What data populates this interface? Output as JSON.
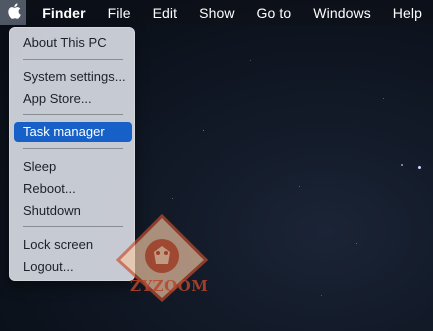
{
  "menubar": {
    "apple_icon": "apple-logo-icon",
    "items": [
      {
        "label": "Finder"
      },
      {
        "label": "File"
      },
      {
        "label": "Edit"
      },
      {
        "label": "Show"
      },
      {
        "label": "Go to"
      },
      {
        "label": "Windows"
      },
      {
        "label": "Help"
      }
    ]
  },
  "apple_menu": {
    "items": [
      {
        "label": "About This PC"
      },
      {
        "label": "System settings..."
      },
      {
        "label": "App Store..."
      },
      {
        "label": "Task manager",
        "selected": true
      },
      {
        "label": "Sleep"
      },
      {
        "label": "Reboot..."
      },
      {
        "label": "Shutdown"
      },
      {
        "label": "Lock screen"
      },
      {
        "label": "Logout..."
      }
    ]
  },
  "watermark": {
    "text": "ZYZOOM"
  },
  "colors": {
    "selection": "#1660c8",
    "menu_background": "#d2d6de",
    "apple_button_active": "#505866",
    "watermark": "#b8452a"
  }
}
